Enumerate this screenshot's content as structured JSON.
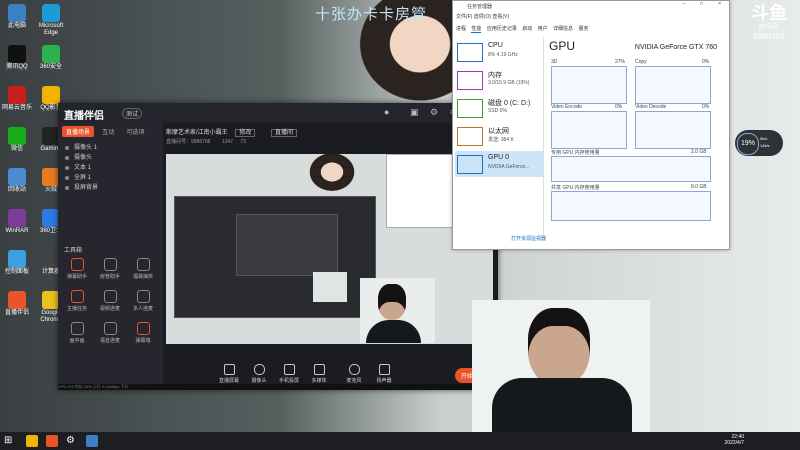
{
  "wallpaper": {
    "banner": "十张办卡卡房管"
  },
  "desktop_icons": [
    {
      "label": "此电脑",
      "color": "#3b7fc4"
    },
    {
      "label": "腾讯QQ",
      "color": "#111"
    },
    {
      "label": "网易云音乐",
      "color": "#c81e1e"
    },
    {
      "label": "微信",
      "color": "#1aad19"
    },
    {
      "label": "回收站",
      "color": "#4a8bd0"
    },
    {
      "label": "WinRAR",
      "color": "#7b3c9c"
    },
    {
      "label": "控制面板",
      "color": "#3aa0e0"
    },
    {
      "label": "直播伴侣",
      "color": "#e9542a"
    },
    {
      "label": "Microsoft Edge",
      "color": "#1d9bd7"
    },
    {
      "label": "360安全",
      "color": "#2bb24c"
    },
    {
      "label": "QQ影音",
      "color": "#f0b400"
    },
    {
      "label": "Gaming",
      "color": "#222"
    },
    {
      "label": "火绒",
      "color": "#e77b21"
    },
    {
      "label": "360卫士",
      "color": "#2c7be5"
    },
    {
      "label": "计算器",
      "color": "#444"
    },
    {
      "label": "Google Chrome",
      "color": "#e9c21d"
    }
  ],
  "app": {
    "logo": "直播伴侣",
    "version": "测试",
    "tabs": [
      "直播场景",
      "互动",
      "可选项"
    ],
    "scenes": [
      "摄像头 1",
      "摄像头",
      "文本 1",
      "全屏 1",
      "投屏背景"
    ],
    "tools_title": "工具箱",
    "tools": [
      {
        "label": "弹幕助手",
        "accent": true
      },
      {
        "label": "房管助手",
        "accent": false
      },
      {
        "label": "福袋抽奖",
        "accent": false
      },
      {
        "label": "主播任务",
        "accent": true
      },
      {
        "label": "视频连麦",
        "accent": false
      },
      {
        "label": "多人连麦",
        "accent": false
      },
      {
        "label": "画中画",
        "accent": false
      },
      {
        "label": "语音连麦",
        "accent": false
      },
      {
        "label": "弹幕墙",
        "accent": true
      }
    ],
    "room_title": "斯摩艺术家/江南小霸王",
    "room_button": "修改",
    "room_tag": "直播间",
    "room_sub": "直播间号：9986798",
    "viewers": "1347",
    "likes": "73",
    "controls": [
      "直播屏幕",
      "摄像头",
      "手机投屏",
      "多媒体",
      "麦克风",
      "扬声器"
    ],
    "live_button": "开始直播",
    "status": "CPU 4% 内存 18% 上行 0.04Mbps 下行"
  },
  "taskmgr": {
    "title": "任务管理器",
    "menu": "文件(F)   选项(O)   查看(V)",
    "tabs": [
      "进程",
      "性能",
      "应用历史记录",
      "启动",
      "用户",
      "详细信息",
      "服务"
    ],
    "active_tab": "性能",
    "resources": [
      {
        "name": "CPU",
        "sub": "8% 4.19 GHz",
        "selected": false
      },
      {
        "name": "内存",
        "sub": "3.0/15.9 GB (19%)",
        "selected": false
      },
      {
        "name": "磁盘 0 (C: D:)",
        "sub": "SSD 0%",
        "selected": false
      },
      {
        "name": "以太网",
        "sub": "发送: 384 K",
        "selected": false
      },
      {
        "name": "GPU 0",
        "sub": "NVIDIA GeForce...",
        "selected": true
      }
    ],
    "gpu_heading": "GPU",
    "gpu_name": "NVIDIA GeForce GTX 760",
    "graphs": [
      "3D",
      "Copy",
      "Video Encode",
      "Video Decode"
    ],
    "graph_pcts": [
      "27%",
      "0%",
      "0%",
      "0%"
    ],
    "mem_labels": [
      "专用 GPU 内存使用量",
      "共享 GPU 内存使用量"
    ],
    "mem_sizes": [
      "2.0 GB",
      "8.0 GB"
    ],
    "footer": "打开资源监视器"
  },
  "overlay": {
    "logo": "斗鱼",
    "logo_sub": "房间号",
    "room_no": "9986798"
  },
  "sysgauge": {
    "pct": "19%",
    "up": "0k/s",
    "down": "14k/s"
  },
  "taskbar": {
    "time": "22:40",
    "date": "2022/4/7"
  }
}
